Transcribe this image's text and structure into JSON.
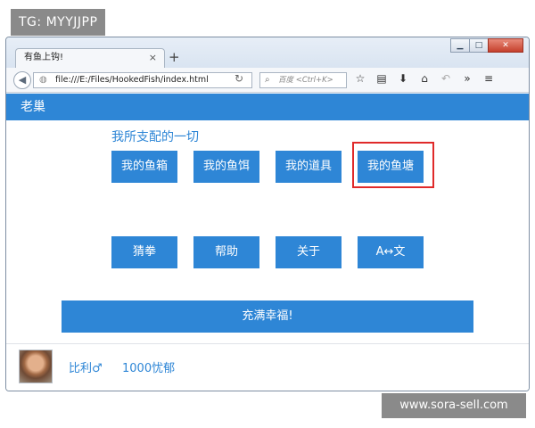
{
  "overlay": {
    "tg_label": "TG: MYYJJPP",
    "watermark": "www.sora-sell.com"
  },
  "browser": {
    "tab_title": "有鱼上钩!",
    "tab_close": "×",
    "new_tab": "+",
    "url": "file:///E:/Files/HookedFish/index.html",
    "search_placeholder": "百度 <Ctrl+K>",
    "window_controls": {
      "minimize": "▁",
      "maximize": "□",
      "close": "✕"
    },
    "icons": [
      "star-icon",
      "reading-list-icon",
      "download-icon",
      "home-icon",
      "undo-icon",
      "overflow-icon",
      "menu-icon"
    ]
  },
  "header": {
    "title": "老巢"
  },
  "main": {
    "section_title": "我所支配的一切",
    "row1": [
      "我的鱼箱",
      "我的鱼饵",
      "我的道具",
      "我的鱼塘"
    ],
    "row2": [
      "猜拳",
      "帮助",
      "关于",
      "A↔文"
    ],
    "happy_button": "充满幸福!"
  },
  "footer": {
    "user_name": "比利♂",
    "user_mood": "1000忧郁"
  },
  "colors": {
    "accent": "#2e86d6",
    "highlight": "#e02a2a"
  }
}
